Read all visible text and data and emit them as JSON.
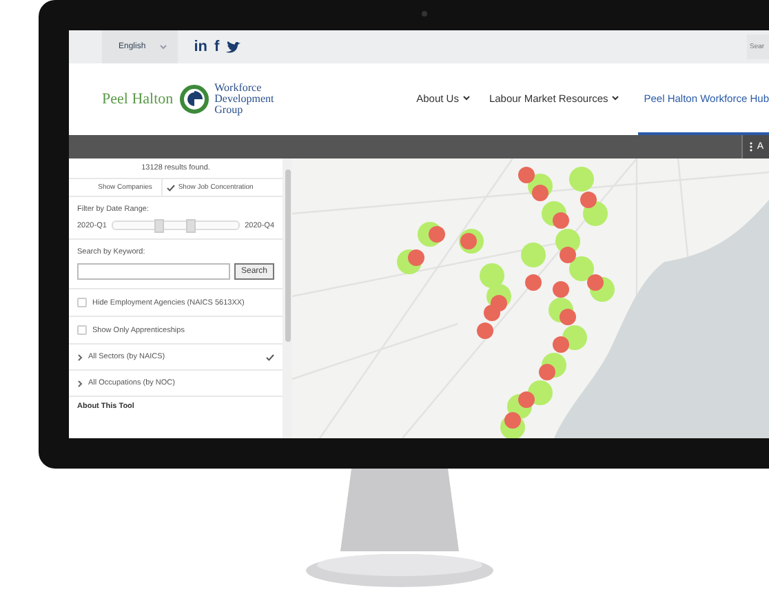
{
  "topbar": {
    "language": "English",
    "social": [
      {
        "kind": "linkedin",
        "label": "in"
      },
      {
        "kind": "facebook",
        "label": "f"
      },
      {
        "kind": "twitter"
      }
    ],
    "search": {
      "placeholder": "Sear"
    }
  },
  "header": {
    "logo": {
      "name": "Peel Halton",
      "subtitle": [
        "Workforce",
        "Development",
        "Group"
      ]
    },
    "nav": [
      {
        "label": "About Us",
        "dropdown": true,
        "selected": false
      },
      {
        "label": "Labour Market Resources",
        "dropdown": true,
        "selected": false
      },
      {
        "label": "Peel Halton Workforce Hub",
        "dropdown": false,
        "selected": true
      }
    ]
  },
  "toolbar": {
    "menu_label": "A"
  },
  "panel": {
    "results": "13128 results found.",
    "toggles": [
      {
        "label": "Show Companies",
        "selected": false
      },
      {
        "label": "Show Job Concentration",
        "selected": true
      }
    ],
    "date_filter": {
      "label": "Filter by Date Range:",
      "start": "2020-Q1",
      "end": "2020-Q4",
      "thumbs": [
        {
          "level": 0.36
        },
        {
          "level": 0.62
        }
      ]
    },
    "keyword": {
      "label": "Search by Keyword:",
      "button": "Search"
    },
    "checkboxes": [
      {
        "label": "Hide Employment Agencies (NAICS 5613XX)",
        "checked": false
      },
      {
        "label": "Show Only Apprenticeships",
        "checked": false
      }
    ],
    "groups": [
      {
        "label": "All Sectors (by NAICS)",
        "expanded": false,
        "checked": true
      },
      {
        "label": "All Occupations (by NOC)",
        "expanded": false,
        "checked": false
      }
    ],
    "about": "About This Tool"
  }
}
